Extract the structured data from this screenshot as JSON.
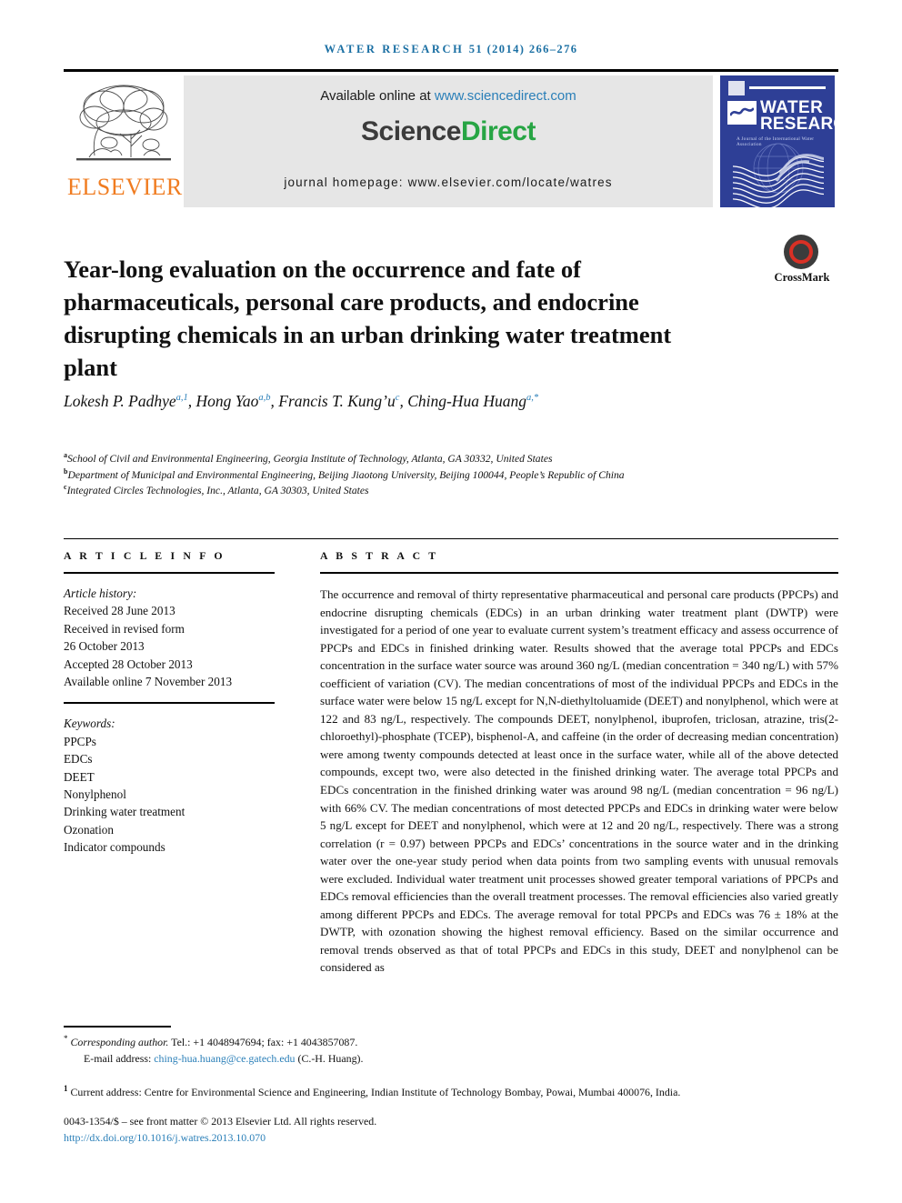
{
  "running_head": {
    "journal": "WATER RESEARCH",
    "volume_year_pages": "51 (2014) 266–276"
  },
  "masthead": {
    "available_prefix": "Available online at ",
    "sciencedirect_url": "www.sciencedirect.com",
    "logo_part1": "Science",
    "logo_part2": "Direct",
    "homepage": "journal homepage: www.elsevier.com/locate/watres",
    "publisher_logo_text": "ELSEVIER",
    "cover": {
      "title_line1": "WATER",
      "title_line2": "RESEARCH",
      "subtitle": "A Journal of the International Water Association"
    }
  },
  "crossmark": {
    "label": "CrossMark"
  },
  "article": {
    "title": "Year-long evaluation on the occurrence and fate of pharmaceuticals, personal care products, and endocrine disrupting chemicals in an urban drinking water treatment plant",
    "authors": [
      {
        "name": "Lokesh P. Padhye",
        "marks": "a,1",
        "sep": ", "
      },
      {
        "name": "Hong Yao",
        "marks": "a,b",
        "sep": ", "
      },
      {
        "name": "Francis T. Kung’u",
        "marks": "c",
        "sep": ", "
      },
      {
        "name": "Ching-Hua Huang",
        "marks": "a,*",
        "sep": ""
      }
    ],
    "affiliations": [
      {
        "mark": "a",
        "text": "School of Civil and Environmental Engineering, Georgia Institute of Technology, Atlanta, GA 30332, United States"
      },
      {
        "mark": "b",
        "text": "Department of Municipal and Environmental Engineering, Beijing Jiaotong University, Beijing 100044, People’s Republic of China"
      },
      {
        "mark": "c",
        "text": "Integrated Circles Technologies, Inc., Atlanta, GA 30303, United States"
      }
    ]
  },
  "article_info": {
    "heading": "A R T I C L E  I N F O",
    "history_label": "Article history:",
    "history": [
      "Received 28 June 2013",
      "Received in revised form",
      "26 October 2013",
      "Accepted 28 October 2013",
      "Available online 7 November 2013"
    ],
    "keywords_label": "Keywords:",
    "keywords": [
      "PPCPs",
      "EDCs",
      "DEET",
      "Nonylphenol",
      "Drinking water treatment",
      "Ozonation",
      "Indicator compounds"
    ]
  },
  "abstract": {
    "heading": "A B S T R A C T",
    "text": "The occurrence and removal of thirty representative pharmaceutical and personal care products (PPCPs) and endocrine disrupting chemicals (EDCs) in an urban drinking water treatment plant (DWTP) were investigated for a period of one year to evaluate current system’s treatment efficacy and assess occurrence of PPCPs and EDCs in finished drinking water. Results showed that the average total PPCPs and EDCs concentration in the surface water source was around 360 ng/L (median concentration = 340 ng/L) with 57% coefficient of variation (CV). The median concentrations of most of the individual PPCPs and EDCs in the surface water were below 15 ng/L except for N,N-diethyltoluamide (DEET) and nonylphenol, which were at 122 and 83 ng/L, respectively. The compounds DEET, nonylphenol, ibuprofen, triclosan, atrazine, tris(2-chloroethyl)-phosphate (TCEP), bisphenol-A, and caffeine (in the order of decreasing median concentration) were among twenty compounds detected at least once in the surface water, while all of the above detected compounds, except two, were also detected in the finished drinking water. The average total PPCPs and EDCs concentration in the finished drinking water was around 98 ng/L (median concentration = 96 ng/L) with 66% CV. The median concentrations of most detected PPCPs and EDCs in drinking water were below 5 ng/L except for DEET and nonylphenol, which were at 12 and 20 ng/L, respectively. There was a strong correlation (r = 0.97) between PPCPs and EDCs’ concentrations in the source water and in the drinking water over the one-year study period when data points from two sampling events with unusual removals were excluded. Individual water treatment unit processes showed greater temporal variations of PPCPs and EDCs removal efficiencies than the overall treatment processes. The removal efficiencies also varied greatly among different PPCPs and EDCs. The average removal for total PPCPs and EDCs was 76 ± 18% at the DWTP, with ozonation showing the highest removal efficiency. Based on the similar occurrence and removal trends observed as that of total PPCPs and EDCs in this study, DEET and nonylphenol can be considered as"
  },
  "footer": {
    "corresponding_mark": "*",
    "corresponding_text": "Corresponding author.",
    "corresponding_contact": " Tel.: +1 4048947694; fax: +1 4043857087.",
    "email_label": "E-mail address: ",
    "email": "ching-hua.huang@ce.gatech.edu",
    "email_suffix": " (C.-H. Huang).",
    "footnote1_mark": "1",
    "footnote1": "Current address: Centre for Environmental Science and Engineering, Indian Institute of Technology Bombay, Powai, Mumbai 400076, India.",
    "issn_line": "0043-1354/$ – see front matter © 2013 Elsevier Ltd. All rights reserved.",
    "doi": "http://dx.doi.org/10.1016/j.watres.2013.10.070"
  },
  "colors": {
    "link_blue": "#2a7fb8",
    "header_blue": "#1a6fa3",
    "sciencedirect_green": "#27a544",
    "elsevier_orange": "#f07c20",
    "cover_blue": "#2e3f96",
    "crossmark_red": "#d93025"
  }
}
